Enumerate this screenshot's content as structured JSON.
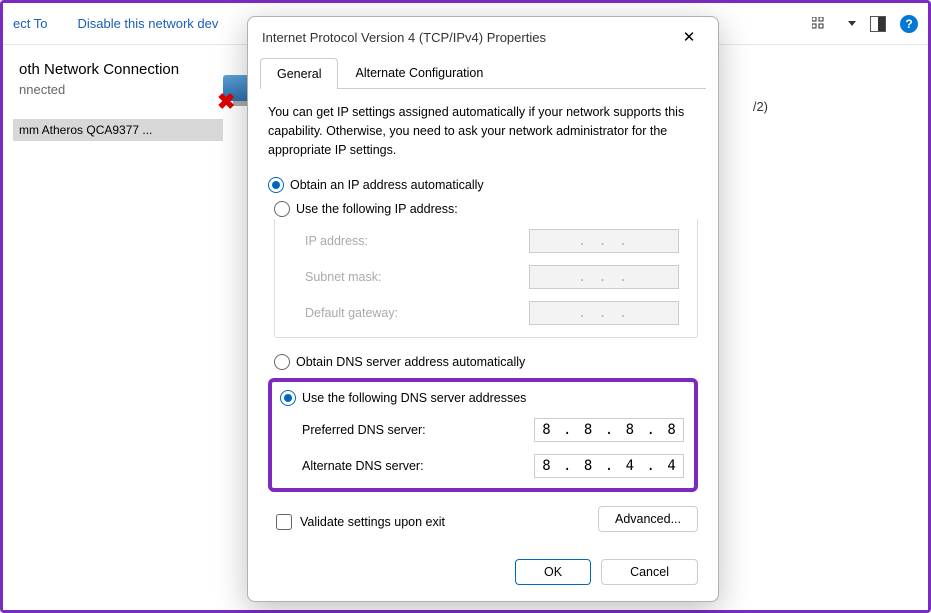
{
  "bg": {
    "toolbar": {
      "connect_to": "ect To",
      "disable": "Disable this network dev"
    },
    "connection": {
      "title": "oth Network Connection",
      "status": "nnected",
      "device": "mm Atheros QCA9377 ..."
    },
    "split_text": "/2)"
  },
  "dialog": {
    "title": "Internet Protocol Version 4 (TCP/IPv4) Properties",
    "tabs": {
      "general": "General",
      "alternate": "Alternate Configuration"
    },
    "intro": "You can get IP settings assigned automatically if your network supports this capability. Otherwise, you need to ask your network administrator for the appropriate IP settings.",
    "ip": {
      "auto": "Obtain an IP address automatically",
      "manual": "Use the following IP address:",
      "ip_label": "IP address:",
      "subnet_label": "Subnet mask:",
      "gateway_label": "Default gateway:",
      "placeholder": ".   .   ."
    },
    "dns": {
      "auto": "Obtain DNS server address automatically",
      "manual": "Use the following DNS server addresses",
      "preferred_label": "Preferred DNS server:",
      "alternate_label": "Alternate DNS server:",
      "preferred_value": "8 . 8 . 8 . 8",
      "alternate_value": "8 . 8 . 4 . 4"
    },
    "validate": "Validate settings upon exit",
    "advanced": "Advanced...",
    "ok": "OK",
    "cancel": "Cancel"
  }
}
